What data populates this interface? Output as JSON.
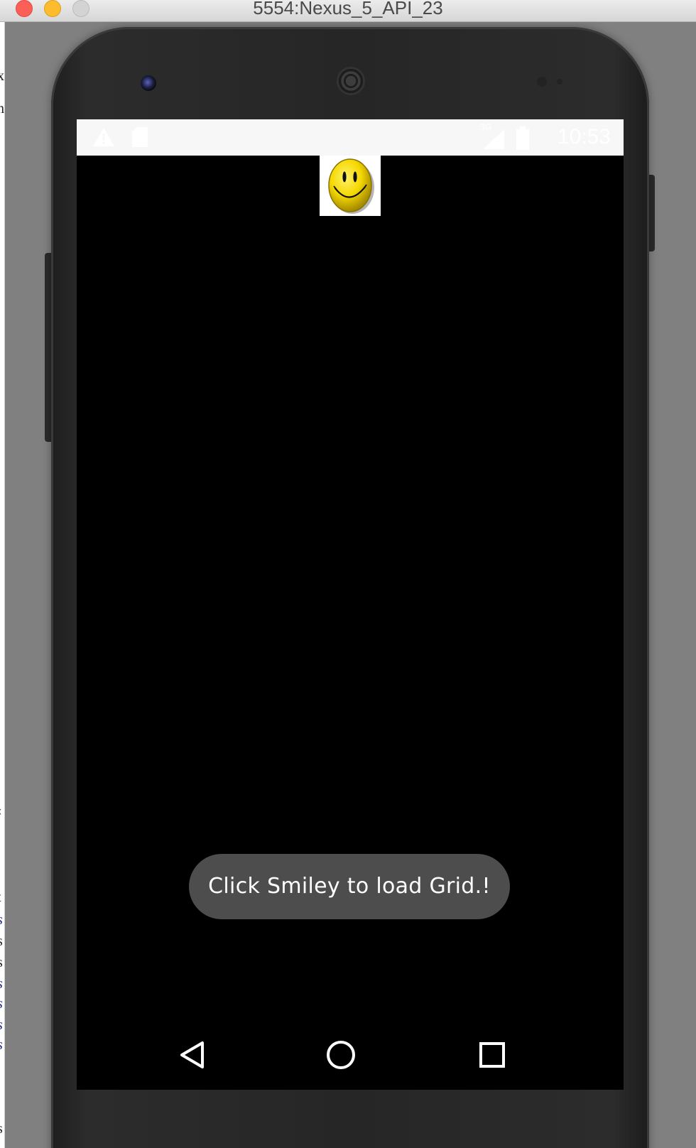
{
  "window": {
    "title": "5554:Nexus_5_API_23"
  },
  "background_app": {
    "side_glyphs": [
      "x",
      "n",
      "‹",
      "t",
      "s",
      "s",
      "s",
      "s",
      "s",
      "s",
      "s",
      "s"
    ]
  },
  "status_bar": {
    "icons": [
      "warning-icon",
      "sd-card-icon",
      "signal-icon",
      "battery-icon"
    ],
    "signal_label": "3G",
    "time": "10:53"
  },
  "app": {
    "smiley_button_icon": "smiley-face-icon"
  },
  "toast": {
    "message": "Click Smiley to load Grid.!"
  },
  "nav_bar": {
    "buttons": [
      "back-icon",
      "home-icon",
      "recents-icon"
    ]
  },
  "colors": {
    "screen_background": "#000000",
    "status_bar": "#f7f7f7",
    "toast_background": "#4d4d4d",
    "smiley_yellow": "#f5d800"
  }
}
